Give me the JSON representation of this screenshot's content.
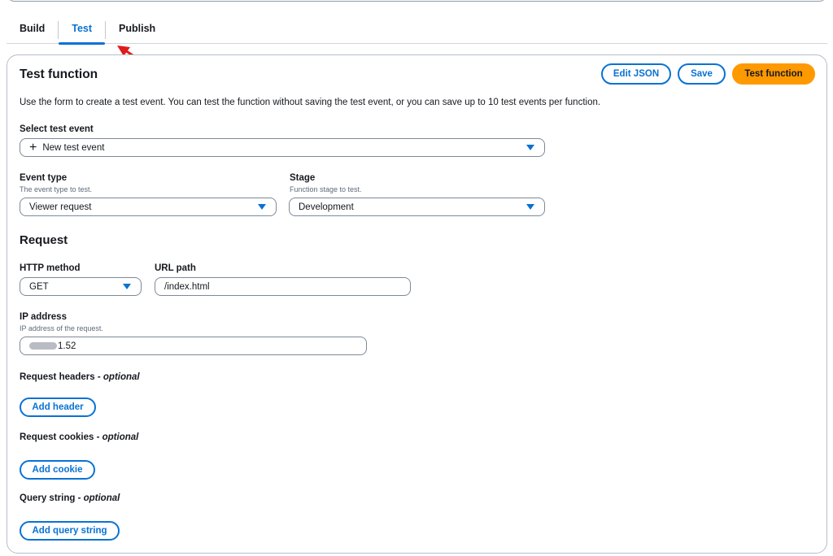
{
  "tabs": [
    {
      "label": "Build",
      "active": false
    },
    {
      "label": "Test",
      "active": true
    },
    {
      "label": "Publish",
      "active": false
    }
  ],
  "panel": {
    "title": "Test function",
    "description": "Use the form to create a test event. You can test the function without saving the test event, or you can save up to 10 test events per function.",
    "actions": {
      "edit_json": "Edit JSON",
      "save": "Save",
      "test_function": "Test function"
    }
  },
  "test_event": {
    "label": "Select test event",
    "value": "New test event"
  },
  "event_type": {
    "label": "Event type",
    "description": "The event type to test.",
    "value": "Viewer request"
  },
  "stage": {
    "label": "Stage",
    "description": "Function stage to test.",
    "value": "Development"
  },
  "request": {
    "title": "Request",
    "http_method": {
      "label": "HTTP method",
      "value": "GET"
    },
    "url_path": {
      "label": "URL path",
      "value": "/index.html"
    },
    "ip_address": {
      "label": "IP address",
      "description": "IP address of the request.",
      "value_visible": "1.52"
    },
    "headers": {
      "label": "Request headers - ",
      "optional": "optional",
      "button": "Add header"
    },
    "cookies": {
      "label": "Request cookies - ",
      "optional": "optional",
      "button": "Add cookie"
    },
    "query": {
      "label": "Query string - ",
      "optional": "optional",
      "button": "Add query string"
    }
  },
  "colors": {
    "accent": "#0972d3",
    "primary_button": "#ff9900",
    "annotation_arrow": "#e01b1b"
  }
}
